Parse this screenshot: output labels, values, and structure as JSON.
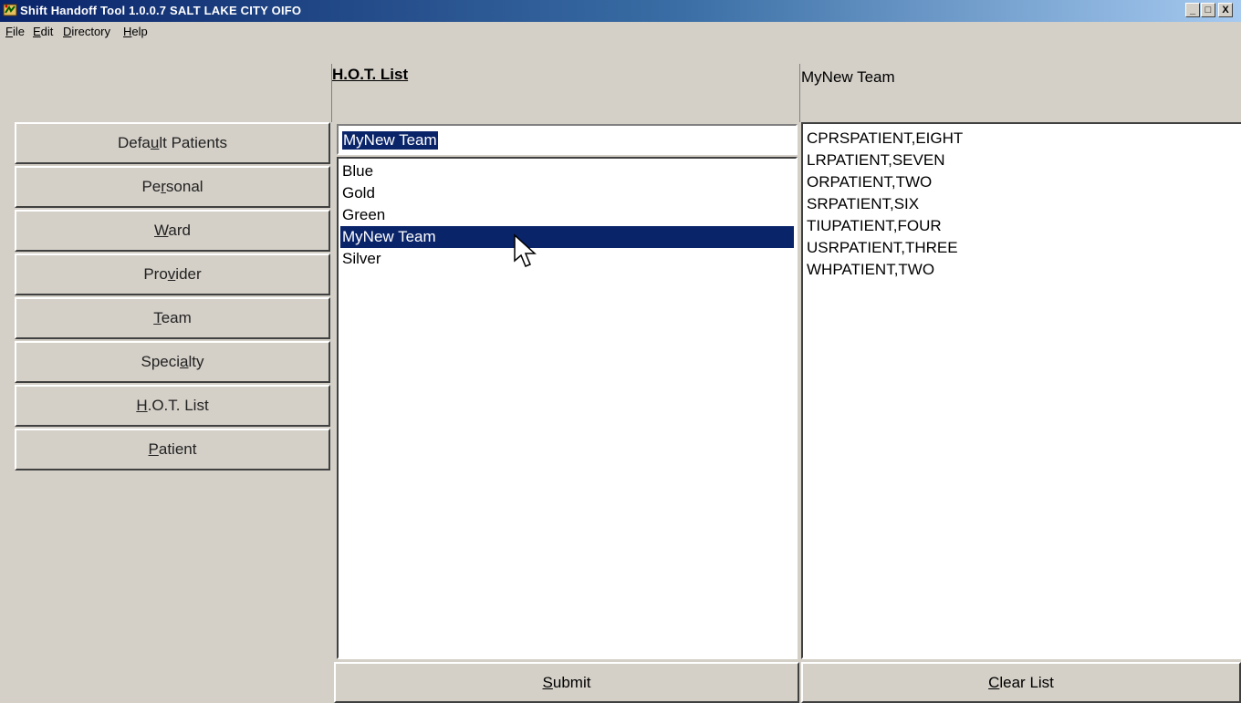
{
  "window": {
    "title": "Shift Handoff Tool 1.0.0.7  SALT LAKE CITY OIFO",
    "minimize": "_",
    "maximize": "□",
    "close": "X"
  },
  "menu": {
    "items": [
      {
        "ul": "F",
        "rest": "ile"
      },
      {
        "ul": "E",
        "rest": "dit"
      },
      {
        "ul": "D",
        "rest": "irectory"
      },
      {
        "ul": "H",
        "rest": "elp"
      }
    ]
  },
  "nav": {
    "buttons": [
      {
        "pre": "Defa",
        "ul": "u",
        "post": "lt Patients"
      },
      {
        "pre": "Pe",
        "ul": "r",
        "post": "sonal"
      },
      {
        "pre": "",
        "ul": "W",
        "post": "ard"
      },
      {
        "pre": "Pro",
        "ul": "v",
        "post": "ider"
      },
      {
        "pre": "",
        "ul": "T",
        "post": "eam"
      },
      {
        "pre": "Speci",
        "ul": "a",
        "post": "lty"
      },
      {
        "pre": "",
        "ul": "H",
        "post": ".O.T. List"
      },
      {
        "pre": "",
        "ul": "P",
        "post": "atient"
      }
    ]
  },
  "hot_list": {
    "header": "H.O.T. List",
    "input_value": "MyNew Team",
    "items": [
      "Blue",
      "Gold",
      "Green",
      "MyNew Team",
      "Silver"
    ],
    "selected": "MyNew Team"
  },
  "team_panel": {
    "header": "MyNew Team",
    "patients": [
      "CPRSPATIENT,EIGHT",
      "LRPATIENT,SEVEN",
      "ORPATIENT,TWO",
      "SRPATIENT,SIX",
      "TIUPATIENT,FOUR",
      "USRPATIENT,THREE",
      "WHPATIENT,TWO"
    ]
  },
  "buttons": {
    "submit": {
      "ul": "S",
      "rest": "ubmit"
    },
    "clear": {
      "ul": "C",
      "rest": "lear List"
    }
  }
}
